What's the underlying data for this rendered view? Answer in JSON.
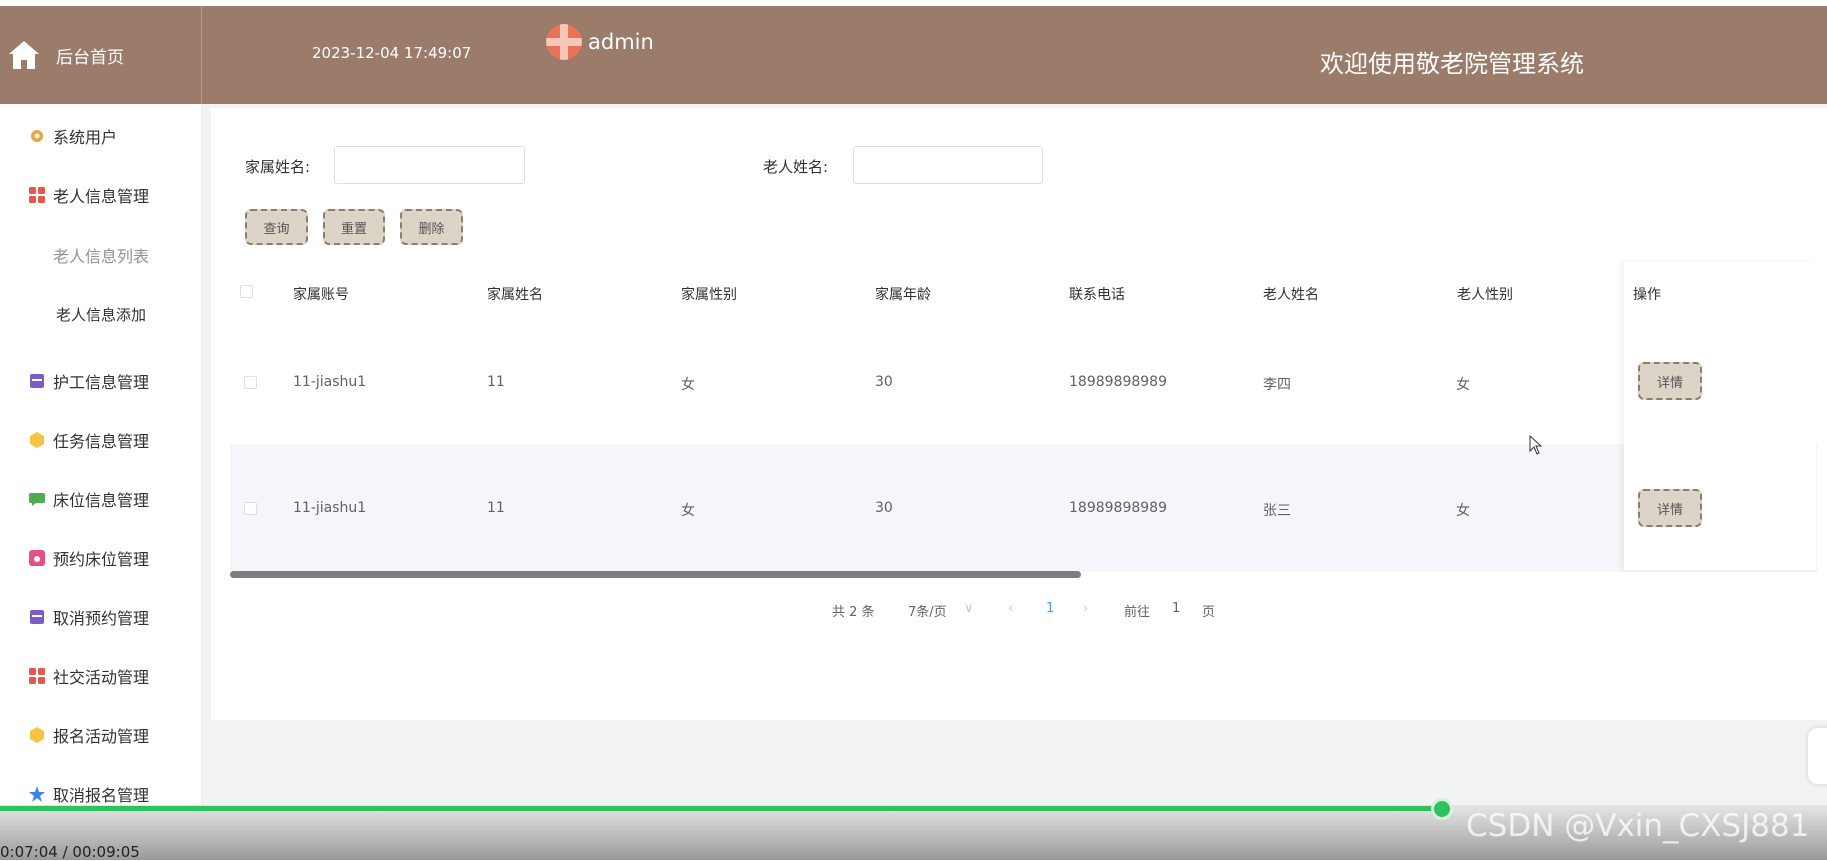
{
  "header": {
    "home_label": "后台首页",
    "datetime": "2023-12-04 17:49:07",
    "username": "admin",
    "welcome": "欢迎使用敬老院管理系统",
    "bg_color": "#9b7b6a"
  },
  "sidebar": {
    "items": [
      {
        "label": "系统用户",
        "icon": "gear-icon",
        "color": "#f0a33c"
      },
      {
        "label": "老人信息管理",
        "icon": "grid-icon",
        "color": "#e8584a"
      },
      {
        "label": "老人信息列表",
        "sub": true
      },
      {
        "label": "老人信息添加",
        "sub": true
      },
      {
        "label": "护工信息管理",
        "icon": "box-icon",
        "color": "#7b5cc9"
      },
      {
        "label": "任务信息管理",
        "icon": "cube-icon",
        "color": "#f6c445"
      },
      {
        "label": "床位信息管理",
        "icon": "chat-icon",
        "color": "#4cae4f"
      },
      {
        "label": "预约床位管理",
        "icon": "camera-icon",
        "color": "#e84f86"
      },
      {
        "label": "取消预约管理",
        "icon": "box-icon",
        "color": "#7b5cc9"
      },
      {
        "label": "社交活动管理",
        "icon": "grid-icon",
        "color": "#e8584a"
      },
      {
        "label": "报名活动管理",
        "icon": "cube-icon",
        "color": "#f6c445"
      },
      {
        "label": "取消报名管理",
        "icon": "star-icon",
        "color": "#3b82f6"
      }
    ]
  },
  "search": {
    "family_name_label": "家属姓名:",
    "family_name_value": "",
    "elder_name_label": "老人姓名:",
    "elder_name_value": "",
    "query_btn": "查询",
    "reset_btn": "重置",
    "delete_btn": "删除"
  },
  "table": {
    "columns": [
      "家属账号",
      "家属姓名",
      "家属性别",
      "家属年龄",
      "联系电话",
      "老人姓名",
      "老人性别",
      "操作"
    ],
    "rows": [
      {
        "account": "11-jiashu1",
        "name": "11",
        "gender": "女",
        "age": "30",
        "phone": "18989898989",
        "elder": "李四",
        "elder_gender": "女",
        "action": "详情"
      },
      {
        "account": "11-jiashu1",
        "name": "11",
        "gender": "女",
        "age": "30",
        "phone": "18989898989",
        "elder": "张三",
        "elder_gender": "女",
        "action": "详情"
      }
    ]
  },
  "pagination": {
    "total": "共 2 条",
    "page_size": "7条/页",
    "current": "1",
    "goto_label": "前往",
    "goto_value": "1",
    "page_unit": "页"
  },
  "video": {
    "time": "0:07:04 / 00:09:05",
    "watermark": "CSDN @Vxin_CXSJ881",
    "progress": 0.79
  }
}
